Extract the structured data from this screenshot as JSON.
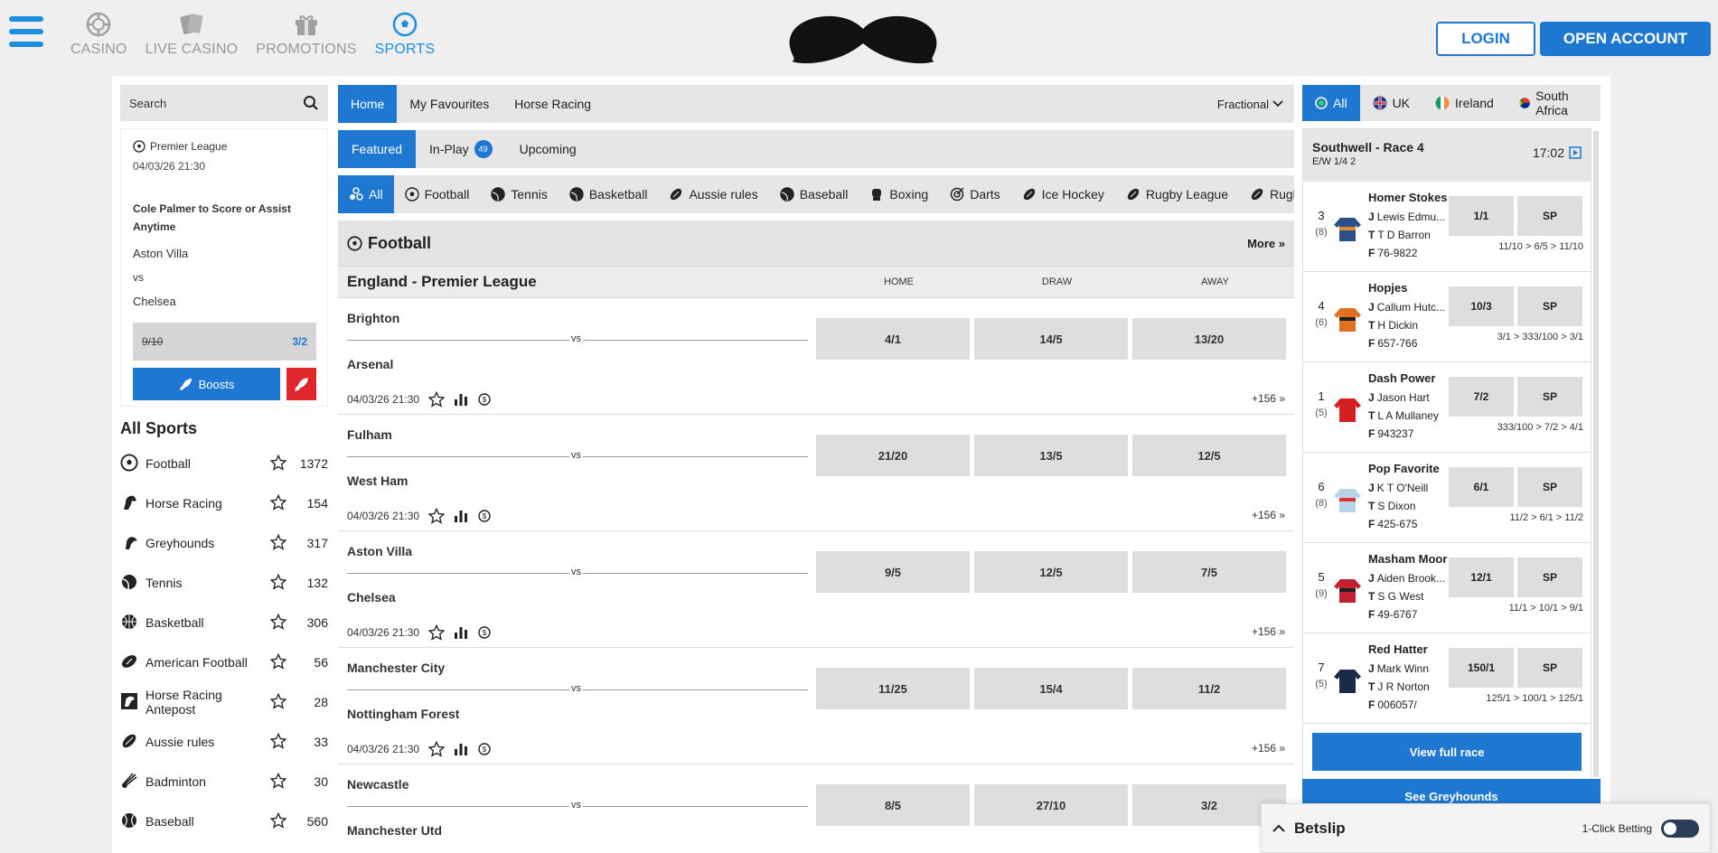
{
  "topnav": {
    "items": [
      {
        "label": "CASINO",
        "icon": "casino-chip-icon"
      },
      {
        "label": "LIVE CASINO",
        "icon": "cards-icon"
      },
      {
        "label": "PROMOTIONS",
        "icon": "gift-icon"
      },
      {
        "label": "SPORTS",
        "icon": "football-icon",
        "active": true
      }
    ],
    "login": "LOGIN",
    "open_account": "OPEN ACCOUNT",
    "accent": "#1e78d2"
  },
  "left": {
    "search_placeholder": "Search",
    "promo": {
      "league": "Premier League",
      "date": "04/03/26 21:30",
      "title": "Cole Palmer to Score or Assist Anytime",
      "home": "Aston Villa",
      "vs": "vs",
      "away": "Chelsea",
      "old_odds": "9/10",
      "new_odds": "3/2",
      "boosts": "Boosts"
    },
    "all_sports_title": "All Sports",
    "sports": [
      {
        "name": "Football",
        "count": "1372",
        "icon": "football-icon"
      },
      {
        "name": "Horse Racing",
        "count": "154",
        "icon": "horse-icon"
      },
      {
        "name": "Greyhounds",
        "count": "317",
        "icon": "greyhound-icon"
      },
      {
        "name": "Tennis",
        "count": "132",
        "icon": "tennis-icon"
      },
      {
        "name": "Basketball",
        "count": "306",
        "icon": "basketball-icon"
      },
      {
        "name": "American Football",
        "count": "56",
        "icon": "american-football-icon"
      },
      {
        "name": "Horse Racing Antepost",
        "count": "28",
        "icon": "antepost-icon"
      },
      {
        "name": "Aussie rules",
        "count": "33",
        "icon": "aussie-rules-icon"
      },
      {
        "name": "Badminton",
        "count": "30",
        "icon": "badminton-icon"
      },
      {
        "name": "Baseball",
        "count": "560",
        "icon": "baseball-icon"
      }
    ]
  },
  "center": {
    "tabs1": [
      "Home",
      "My Favourites",
      "Horse Racing"
    ],
    "odds_format": "Fractional",
    "tabs2": {
      "featured": "Featured",
      "inplay": "In-Play",
      "inplay_count": "49",
      "upcoming": "Upcoming"
    },
    "sport_tabs": [
      "All",
      "Football",
      "Tennis",
      "Basketball",
      "Aussie rules",
      "Baseball",
      "Boxing",
      "Darts",
      "Ice Hockey",
      "Rugby League",
      "Rugby"
    ],
    "section_title": "Football",
    "more": "More",
    "league": "England - Premier League",
    "cols": [
      "HOME",
      "DRAW",
      "AWAY"
    ],
    "matches": [
      {
        "home": "Brighton",
        "away": "Arsenal",
        "odds": [
          "4/1",
          "14/5",
          "13/20"
        ],
        "date": "04/03/26 21:30",
        "more": "+156"
      },
      {
        "home": "Fulham",
        "away": "West Ham",
        "odds": [
          "21/20",
          "13/5",
          "12/5"
        ],
        "date": "04/03/26 21:30",
        "more": "+156"
      },
      {
        "home": "Aston Villa",
        "away": "Chelsea",
        "odds": [
          "9/5",
          "12/5",
          "7/5"
        ],
        "date": "04/03/26 21:30",
        "more": "+156"
      },
      {
        "home": "Manchester City",
        "away": "Nottingham Forest",
        "odds": [
          "11/25",
          "15/4",
          "11/2"
        ],
        "date": "04/03/26 21:30",
        "more": "+156"
      },
      {
        "home": "Newcastle",
        "away": "Manchester Utd",
        "odds": [
          "8/5",
          "27/10",
          "3/2"
        ],
        "date": "",
        "more": ""
      }
    ],
    "vs": "vs"
  },
  "right": {
    "tabs": [
      "All",
      "UK",
      "Ireland",
      "South Africa"
    ],
    "race_name": "Southwell - Race 4",
    "ew": "E/W 1/4 2",
    "time": "17:02",
    "runners": [
      {
        "num": "3",
        "draw": "(8)",
        "name": "Homer Stokes",
        "jockey": "Lewis Edmu...",
        "trainer": "T D Barron",
        "form": "76-9822",
        "price": "1/1",
        "sp": "SP",
        "history": "11/10 > 6/5 > 11/10",
        "silk": "#2b4f8a",
        "silk2": "#e08b30"
      },
      {
        "num": "4",
        "draw": "(6)",
        "name": "Hopjes",
        "jockey": "Callum Hutc...",
        "trainer": "H Dickin",
        "form": "657-766",
        "price": "10/3",
        "sp": "SP",
        "history": "3/1 > 333/100 > 3/1",
        "silk": "#e07020",
        "silk2": "#222222"
      },
      {
        "num": "1",
        "draw": "(5)",
        "name": "Dash Power",
        "jockey": "Jason Hart",
        "trainer": "L A Mullaney",
        "form": "943237",
        "price": "7/2",
        "sp": "SP",
        "history": "333/100 > 7/2 > 4/1",
        "silk": "#d42020",
        "silk2": "#d42020"
      },
      {
        "num": "6",
        "draw": "(8)",
        "name": "Pop Favorite",
        "jockey": "K T O'Neill",
        "trainer": "S Dixon",
        "form": "425-675",
        "price": "6/1",
        "sp": "SP",
        "history": "11/2 > 6/1 > 11/2",
        "silk": "#b8d4e8",
        "silk2": "#e03030"
      },
      {
        "num": "5",
        "draw": "(9)",
        "name": "Masham Moor",
        "jockey": "Aiden Brook...",
        "trainer": "S G West",
        "form": "49-6767",
        "price": "12/1",
        "sp": "SP",
        "history": "11/1 > 10/1 > 9/1",
        "silk": "#c02030",
        "silk2": "#222222"
      },
      {
        "num": "7",
        "draw": "(5)",
        "name": "Red Hatter",
        "jockey": "Mark Winn",
        "trainer": "J R Norton",
        "form": "006057/",
        "price": "150/1",
        "sp": "SP",
        "history": "125/1 > 100/1 > 125/1",
        "silk": "#1a2a4a",
        "silk2": "#1a2a4a"
      }
    ],
    "view_full": "View full race",
    "see_greyhounds": "See Greyhounds"
  },
  "betslip": {
    "title": "Betslip",
    "one_click": "1-Click Betting"
  }
}
